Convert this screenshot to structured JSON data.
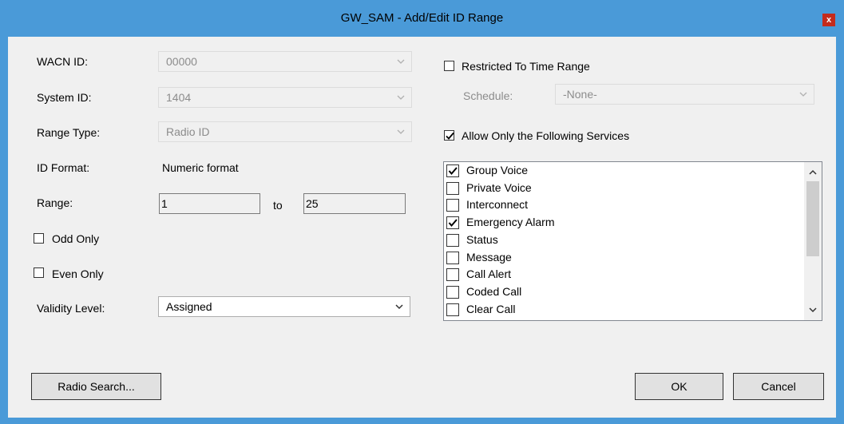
{
  "window": {
    "title": "GW_SAM - Add/Edit ID Range",
    "close_glyph": "x"
  },
  "form": {
    "wacn_label": "WACN ID:",
    "wacn_value": "00000",
    "system_label": "System ID:",
    "system_value": "1404",
    "range_type_label": "Range Type:",
    "range_type_value": "Radio ID",
    "id_format_label": "ID Format:",
    "id_format_value": "Numeric format",
    "range_label": "Range:",
    "range_from": "1",
    "range_to_label": "to",
    "range_to": "25",
    "odd_only_label": "Odd Only",
    "odd_only_checked": false,
    "even_only_label": "Even Only",
    "even_only_checked": false,
    "validity_label": "Validity Level:",
    "validity_value": "Assigned"
  },
  "time": {
    "restricted_label": "Restricted To Time Range",
    "restricted_checked": false,
    "schedule_label": "Schedule:",
    "schedule_value": "-None-"
  },
  "services": {
    "allow_label": "Allow Only the Following Services",
    "allow_checked": true,
    "items": [
      {
        "label": "Group Voice",
        "checked": true
      },
      {
        "label": "Private Voice",
        "checked": false
      },
      {
        "label": "Interconnect",
        "checked": false
      },
      {
        "label": "Emergency Alarm",
        "checked": true
      },
      {
        "label": "Status",
        "checked": false
      },
      {
        "label": "Message",
        "checked": false
      },
      {
        "label": "Call Alert",
        "checked": false
      },
      {
        "label": "Coded Call",
        "checked": false
      },
      {
        "label": "Clear Call",
        "checked": false
      }
    ]
  },
  "buttons": {
    "radio_search": "Radio Search...",
    "ok": "OK",
    "cancel": "Cancel"
  },
  "colors": {
    "title_bar": "#4a9ad8",
    "dialog_bg": "#f0f0f0",
    "close": "#c42b1c"
  }
}
